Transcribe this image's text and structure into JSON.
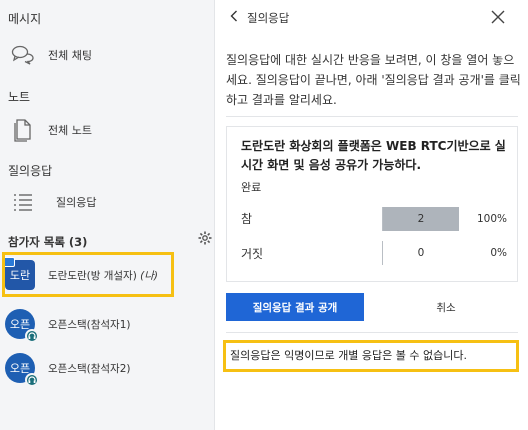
{
  "sidebar": {
    "sections": {
      "messages": "메시지",
      "notes": "노트",
      "qa": "질의응답",
      "participants": "참가자 목록 (3)"
    },
    "items": {
      "all_chat": "전체 채팅",
      "all_notes": "전체 노트",
      "qa": "질의응답"
    },
    "participants": [
      {
        "avatar": "도란",
        "name": "도란도란(방 개설자)",
        "suffix": " (나)"
      },
      {
        "avatar": "오픈",
        "name": "오픈스택(참석자1)",
        "suffix": ""
      },
      {
        "avatar": "오픈",
        "name": "오픈스택(참석자2)",
        "suffix": ""
      }
    ]
  },
  "panel": {
    "title": "질의응답",
    "description": "질의응답에 대한 실시간 반응을 보려면, 이 창을 열어 놓으세요. 질의응답이 끝나면, 아래 '질의응답 결과 공개'를 클릭하고 결과를 알리세요.",
    "question": "도란도란 화상회의 플랫폼은 WEB RTC기반으로 실시간 화면 및 음성 공유가 가능하다.",
    "status": "완료",
    "options": [
      {
        "label": "참",
        "count": "2",
        "percent": "100%",
        "fraction": 1.0
      },
      {
        "label": "거짓",
        "count": "0",
        "percent": "0%",
        "fraction": 0.0
      }
    ],
    "publish_button": "질의응답 결과 공개",
    "cancel_button": "취소",
    "notice": "질의응답은 익명이므로 개별 응답은 볼 수 없습니다."
  },
  "colors": {
    "accent": "#1f66d6",
    "highlight": "#f6c013",
    "bar": "#aeb4bb",
    "avatar": "#1e5fb3"
  }
}
